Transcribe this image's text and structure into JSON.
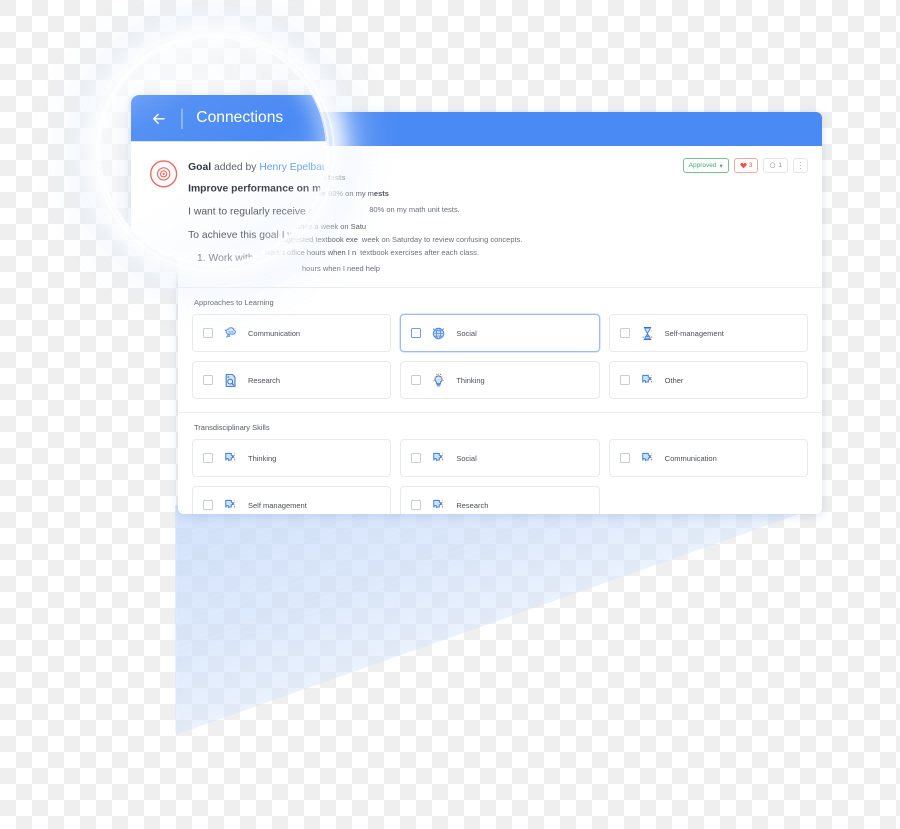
{
  "header": {
    "back_icon": "arrow-left-icon",
    "title": "Connections"
  },
  "goal": {
    "icon": "goal-target-icon",
    "meta_prefix": "Goal",
    "meta_mid": " added by ",
    "author": "Henry Epelbaum",
    "title": "Improve performance on math tests",
    "intro_visible": "I want to regularly receive above 80% on my m",
    "intro_tail": "ests",
    "line2_left": "To achieve this goal I will do:",
    "line2_right": "80% on my math unit tests.",
    "steps": [
      "Work with my tutor once a week on Satu",
      "Complete the suggested textbook exe",
      "Visit Mrs. Risa's office hours when I n"
    ],
    "under_lines": [
      "week on Saturday to review confusing concepts.",
      "textbook exercises after each class.",
      "hours when I need help"
    ]
  },
  "actions": {
    "approved_label": "Approved",
    "approved_caret": "▾",
    "like_icon": "heart-icon",
    "like_count": "3",
    "comment_icon": "comment-bubble-icon",
    "comment_count": "1",
    "more_icon": "kebab-menu-icon"
  },
  "sections": [
    {
      "title": "Approaches to Learning",
      "tiles": [
        {
          "label": "Communication",
          "icon": "speech-cloud-icon",
          "selected": false
        },
        {
          "label": "Social",
          "icon": "globe-icon",
          "selected": true
        },
        {
          "label": "Self-management",
          "icon": "hourglass-icon",
          "selected": false
        },
        {
          "label": "Research",
          "icon": "document-search-icon",
          "selected": false
        },
        {
          "label": "Thinking",
          "icon": "lightbulb-icon",
          "selected": false
        },
        {
          "label": "Other",
          "icon": "puzzle-piece-icon",
          "selected": false
        }
      ]
    },
    {
      "title": "Transdisciplinary Skills",
      "tiles": [
        {
          "label": "Thinking",
          "icon": "puzzle-piece-icon",
          "selected": false
        },
        {
          "label": "Social",
          "icon": "puzzle-piece-icon",
          "selected": false
        },
        {
          "label": "Communication",
          "icon": "puzzle-piece-icon",
          "selected": false
        },
        {
          "label": "Self management",
          "icon": "puzzle-piece-icon",
          "selected": false
        },
        {
          "label": "Research",
          "icon": "puzzle-piece-icon",
          "selected": false
        }
      ]
    }
  ],
  "colors": {
    "brand_blue": "#4a8af4",
    "approved_green": "#4aa870",
    "like_red": "#ef5350",
    "link_blue": "#5b9bf8",
    "goal_icon_red": "#f0625f"
  }
}
